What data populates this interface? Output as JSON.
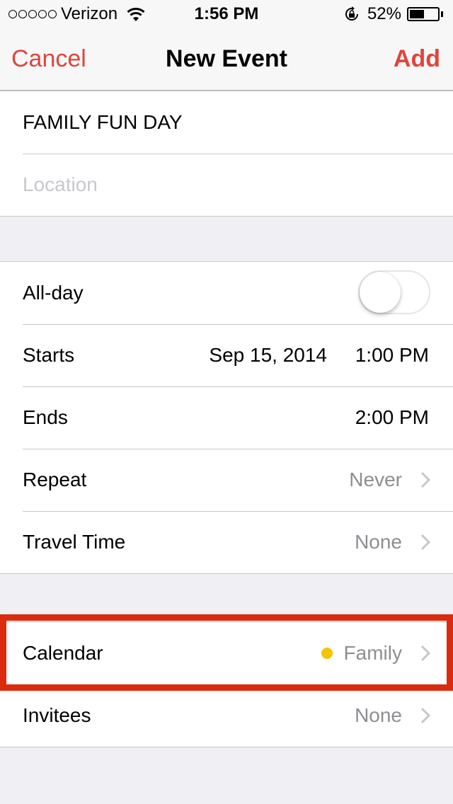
{
  "status_bar": {
    "signal_icon": "signal-dots-icon",
    "signal_dots": 5,
    "carrier": "Verizon",
    "wifi_icon": "wifi-icon",
    "time": "1:56 PM",
    "rotation_lock_icon": "rotation-lock-icon",
    "battery_percent": "52%",
    "battery_level": 0.52,
    "battery_icon": "battery-icon"
  },
  "nav": {
    "cancel_label": "Cancel",
    "title": "New Event",
    "add_label": "Add",
    "accent_color": "#e0453b"
  },
  "event": {
    "title_value": "FAMILY FUN DAY",
    "location_placeholder": "Location",
    "location_value": ""
  },
  "time_section": {
    "allday_label": "All-day",
    "allday_on": false,
    "starts_label": "Starts",
    "starts_date": "Sep 15, 2014",
    "starts_time": "1:00 PM",
    "ends_label": "Ends",
    "ends_time": "2:00 PM",
    "repeat_label": "Repeat",
    "repeat_value": "Never",
    "travel_label": "Travel Time",
    "travel_value": "None"
  },
  "calendar_section": {
    "calendar_label": "Calendar",
    "calendar_value": "Family",
    "calendar_color": "#f5c400",
    "invitees_label": "Invitees",
    "invitees_value": "None"
  },
  "annotation": {
    "highlight_color": "#dc2a0e",
    "highlighted_row": "Calendar"
  }
}
